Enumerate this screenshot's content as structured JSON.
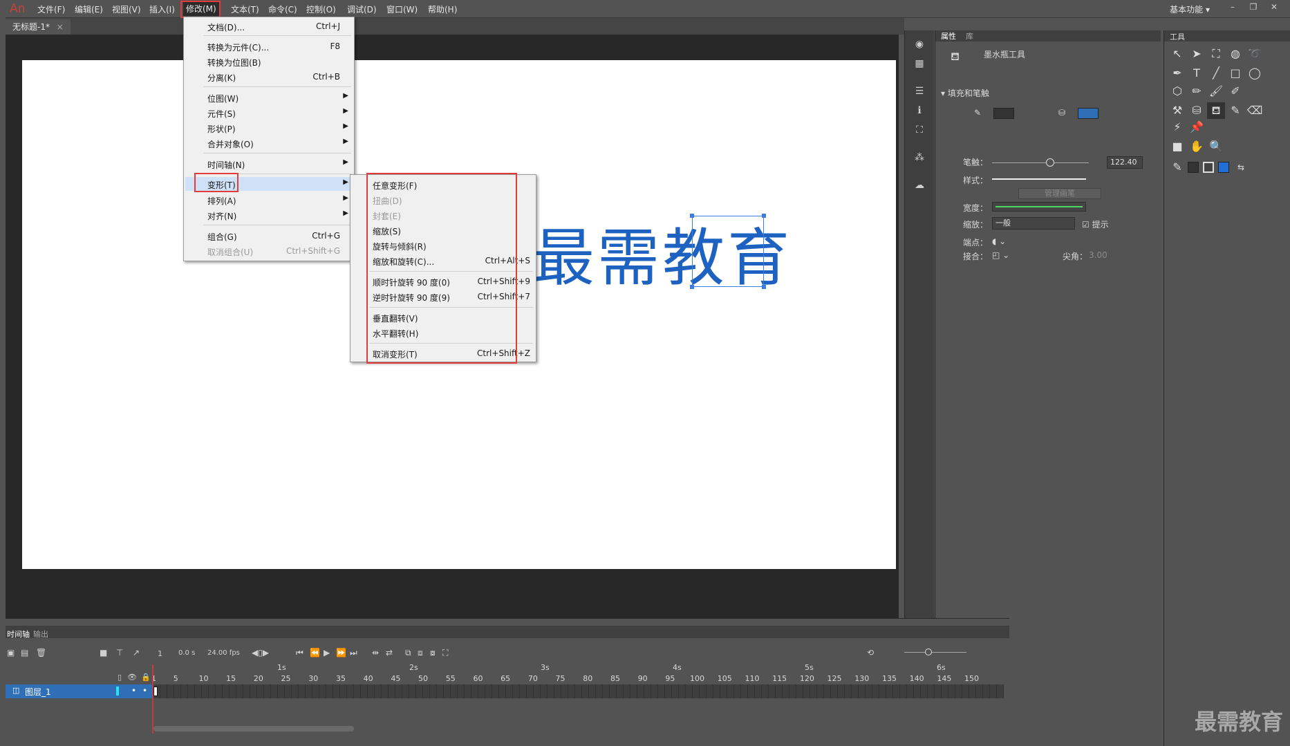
{
  "app": {
    "logo": "An"
  },
  "menubar": {
    "items": [
      "文件(F)",
      "编辑(E)",
      "视图(V)",
      "插入(I)",
      "修改(M)",
      "文本(T)",
      "命令(C)",
      "控制(O)",
      "调试(D)",
      "窗口(W)",
      "帮助(H)"
    ],
    "workspace": "基本功能 ▾"
  },
  "doc_tab": {
    "label": "无标题-1*",
    "close": "×"
  },
  "stage": {
    "text": "最需教育"
  },
  "modify_menu": {
    "items": [
      {
        "label": "文档(D)...",
        "shortcut": "Ctrl+J"
      },
      {
        "label": "转换为元件(C)...",
        "shortcut": "F8"
      },
      {
        "label": "转换为位图(B)",
        "shortcut": ""
      },
      {
        "label": "分离(K)",
        "shortcut": "Ctrl+B"
      },
      {
        "label": "位图(W)",
        "shortcut": ""
      },
      {
        "label": "元件(S)",
        "shortcut": ""
      },
      {
        "label": "形状(P)",
        "shortcut": ""
      },
      {
        "label": "合并对象(O)",
        "shortcut": ""
      },
      {
        "label": "时间轴(N)",
        "shortcut": ""
      },
      {
        "label": "变形(T)",
        "shortcut": ""
      },
      {
        "label": "排列(A)",
        "shortcut": ""
      },
      {
        "label": "对齐(N)",
        "shortcut": ""
      },
      {
        "label": "组合(G)",
        "shortcut": "Ctrl+G"
      },
      {
        "label": "取消组合(U)",
        "shortcut": "Ctrl+Shift+G"
      }
    ]
  },
  "transform_menu": {
    "items": [
      {
        "label": "任意变形(F)",
        "shortcut": ""
      },
      {
        "label": "扭曲(D)",
        "shortcut": ""
      },
      {
        "label": "封套(E)",
        "shortcut": ""
      },
      {
        "label": "缩放(S)",
        "shortcut": ""
      },
      {
        "label": "旋转与倾斜(R)",
        "shortcut": ""
      },
      {
        "label": "缩放和旋转(C)...",
        "shortcut": "Ctrl+Alt+S"
      },
      {
        "label": "顺时针旋转 90 度(0)",
        "shortcut": "Ctrl+Shift+9"
      },
      {
        "label": "逆时针旋转 90 度(9)",
        "shortcut": "Ctrl+Shift+7"
      },
      {
        "label": "垂直翻转(V)",
        "shortcut": ""
      },
      {
        "label": "水平翻转(H)",
        "shortcut": ""
      },
      {
        "label": "取消变形(T)",
        "shortcut": "Ctrl+Shift+Z"
      }
    ]
  },
  "properties": {
    "tabs": [
      "属性",
      "库"
    ],
    "tool_name": "墨水瓶工具",
    "section": "填充和笔触",
    "stroke_label": "笔触：",
    "stroke_value": "122.40",
    "style_label": "样式：",
    "manage_brush": "管理画笔",
    "width_label": "宽度：",
    "scale_label": "缩放：",
    "scale_value": "一般",
    "hint_label": "提示",
    "cap_label": "端点：",
    "join_label": "接合：",
    "miter_label": "尖角：",
    "miter_value": "3.00",
    "colors": {
      "stroke": "#333333",
      "fill": "#2f6fb5"
    }
  },
  "tools": {
    "title": "工具"
  },
  "timeline": {
    "tabs": [
      "时间轴",
      "输出"
    ],
    "frame": "1",
    "time": "0.0 s",
    "fps": "24.00 fps",
    "seconds": [
      "1s",
      "2s",
      "3s",
      "4s",
      "5s",
      "6s"
    ],
    "frame_ticks": [
      "1",
      "5",
      "10",
      "15",
      "20",
      "25",
      "30",
      "35",
      "40",
      "45",
      "50",
      "55",
      "60",
      "65",
      "70",
      "75",
      "80",
      "85",
      "90",
      "95",
      "100",
      "105",
      "110",
      "115",
      "120",
      "125",
      "130",
      "135",
      "140",
      "145",
      "150"
    ],
    "layer_name": "图层_1"
  },
  "watermark": "最需教育"
}
